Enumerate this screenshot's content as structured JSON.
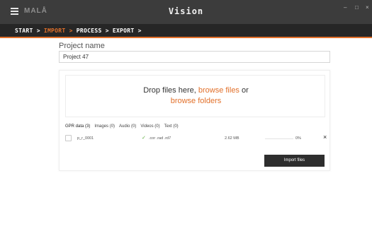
{
  "window": {
    "brand": "MALÅ",
    "title": "Vision",
    "minimize": "–",
    "maximize": "□",
    "close": "×"
  },
  "wizard": {
    "steps": [
      "START >",
      "IMPORT >",
      "PROCESS >",
      "EXPORT >"
    ],
    "active_index": 1
  },
  "project": {
    "label": "Project name",
    "value": "Project 47"
  },
  "dropzone": {
    "text": "Drop files here,",
    "browse_files": "browse files",
    "or": "or",
    "browse_folders": "browse folders"
  },
  "tabs": [
    "GPR data (3)",
    "Images (0)",
    "Audio (0)",
    "Videos (0)",
    "Text (0)"
  ],
  "file": {
    "name": "p_r_0001",
    "extensions": ".cor .rad .rd7",
    "size": "2.62 MB",
    "progress_text": "0%",
    "progress": 0,
    "remove": "×"
  },
  "import_button": "Import files",
  "colors": {
    "accent": "#e2702a",
    "titlebar": "#3c3c3c",
    "wizard": "#262626",
    "button": "#2e2e2e",
    "success": "#5aab3c"
  },
  "icons": {
    "menu": "hamburger-icon",
    "status": "checkmark-icon",
    "remove": "close-icon"
  }
}
